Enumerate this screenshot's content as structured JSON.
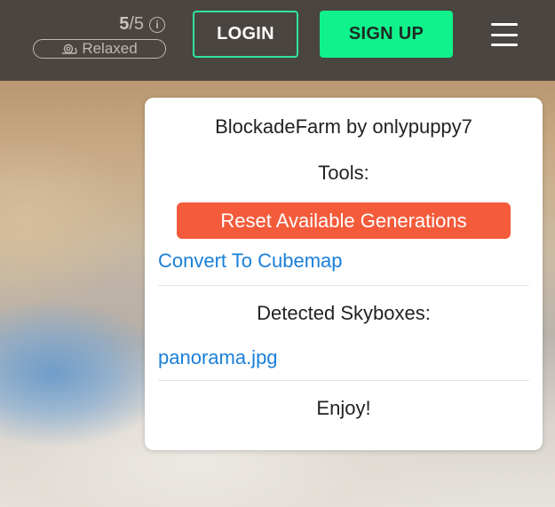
{
  "header": {
    "credits_used": "5",
    "credits_total": "/5",
    "info_icon": "info-icon",
    "mode_label": "Relaxed",
    "mode_icon": "snail-icon",
    "login_label": "LOGIN",
    "signup_label": "SIGN UP",
    "menu_icon": "hamburger-menu-icon",
    "colors": {
      "header_bg": "#4a4541",
      "login_border": "#2ee59d",
      "signup_bg": "#10f28c"
    }
  },
  "panel": {
    "title": "BlockadeFarm by onlypuppy7",
    "tools_label": "Tools:",
    "reset_button_label": "Reset Available Generations",
    "cubemap_link_label": "Convert To Cubemap",
    "skyboxes_label": "Detected Skyboxes:",
    "skybox_files": [
      "panorama.jpg"
    ],
    "footer_text": "Enjoy!",
    "colors": {
      "reset_bg": "#f35b3b",
      "link": "#1a7fd9"
    }
  }
}
